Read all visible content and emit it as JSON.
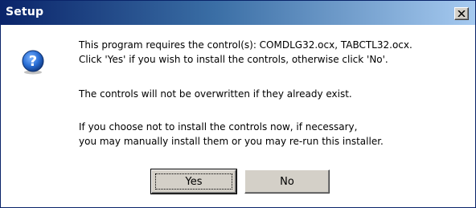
{
  "window": {
    "title": "Setup"
  },
  "message": {
    "line1": "This program requires the control(s): COMDLG32.ocx, TABCTL32.ocx.",
    "line2": "Click 'Yes' if you wish to install the controls, otherwise click 'No'.",
    "line3": "The controls will not be overwritten if they already exist.",
    "line4": "If you choose not to install the controls now, if necessary,",
    "line5": "you may manually install them or you may re-run this installer."
  },
  "buttons": {
    "yes_label": "Yes",
    "no_label": "No"
  },
  "icons": {
    "dialog_icon": "question-icon",
    "close_icon": "close-icon"
  },
  "colors": {
    "titlebar_start": "#0a246a",
    "titlebar_end": "#a6caf0",
    "question_icon": "#1c5cb8"
  }
}
